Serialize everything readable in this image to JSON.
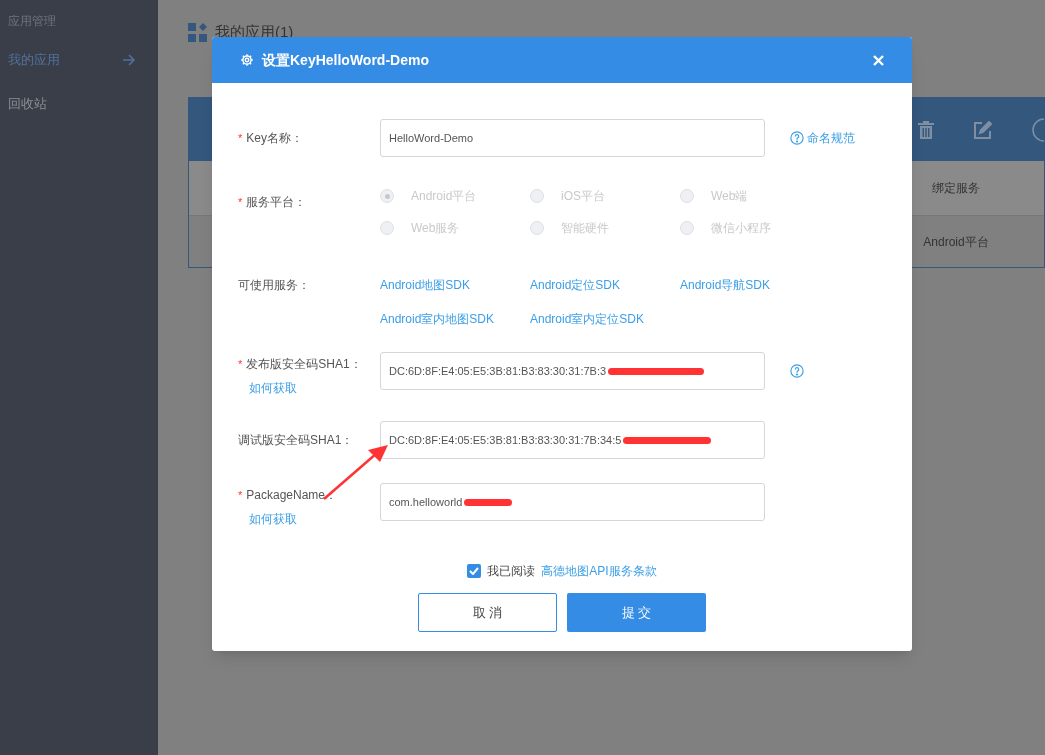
{
  "sidebar": {
    "heading": "应用管理",
    "items": [
      {
        "label": "我的应用",
        "selected": true
      },
      {
        "label": "回收站",
        "selected": false
      }
    ]
  },
  "page": {
    "title": "我的应用(1)",
    "table": {
      "columns": [
        "绑定服务"
      ],
      "rows": [
        [
          "Android平台"
        ]
      ]
    }
  },
  "dialog": {
    "title": "设置KeyHelloWord-Demo",
    "key_name": {
      "label": "Key名称：",
      "required_mark": "*",
      "value": "HelloWord-Demo",
      "help": "命名规范"
    },
    "platform": {
      "label": "服务平台：",
      "required_mark": "*",
      "disabled": true,
      "options": [
        {
          "label": "Android平台",
          "selected": true
        },
        {
          "label": "iOS平台",
          "selected": false
        },
        {
          "label": "Web端",
          "selected": false
        },
        {
          "label": "Web服务",
          "selected": false
        },
        {
          "label": "智能硬件",
          "selected": false
        },
        {
          "label": "微信小程序",
          "selected": false
        }
      ]
    },
    "services": {
      "label": "可使用服务：",
      "items": [
        "Android地图SDK",
        "Android定位SDK",
        "Android导航SDK",
        "Android室内地图SDK",
        "Android室内定位SDK"
      ]
    },
    "release_sha1": {
      "label": "发布版安全码SHA1：",
      "required_mark": "*",
      "link": "如何获取",
      "value": "DC:6D:8F:E4:05:E5:3B:81:B3:83:30:31:7B:3",
      "help_icon": true
    },
    "debug_sha1": {
      "label": "调试版安全码SHA1：",
      "value": "DC:6D:8F:E4:05:E5:3B:81:B3:83:30:31:7B:34:5"
    },
    "package_name": {
      "label": "PackageName：",
      "required_mark": "*",
      "link": "如何获取",
      "value": "com.helloworld"
    },
    "agreement": {
      "checked": true,
      "text": "我已阅读",
      "link": "高德地图API服务条款"
    },
    "buttons": [
      "取 消",
      "提 交"
    ]
  }
}
